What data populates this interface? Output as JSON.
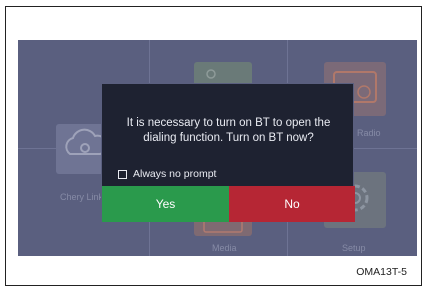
{
  "home_screen": {
    "tiles": [
      {
        "label": "Chery Link",
        "icon": "chery-link-icon"
      },
      {
        "label": "",
        "icon": "navigation-icon"
      },
      {
        "label": "Radio",
        "icon": "radio-icon"
      },
      {
        "label": "Media",
        "icon": "media-icon"
      },
      {
        "label": "Setup",
        "icon": "setup-gear-icon"
      }
    ]
  },
  "dialog": {
    "message": "It is necessary to turn on BT to open the dialing function. Turn on BT now?",
    "checkbox_label": "Always no prompt",
    "checkbox_checked": false,
    "yes_label": "Yes",
    "no_label": "No",
    "yes_color": "#2a9a4c",
    "no_color": "#b62634"
  },
  "figure_code": "OMA13T-5"
}
